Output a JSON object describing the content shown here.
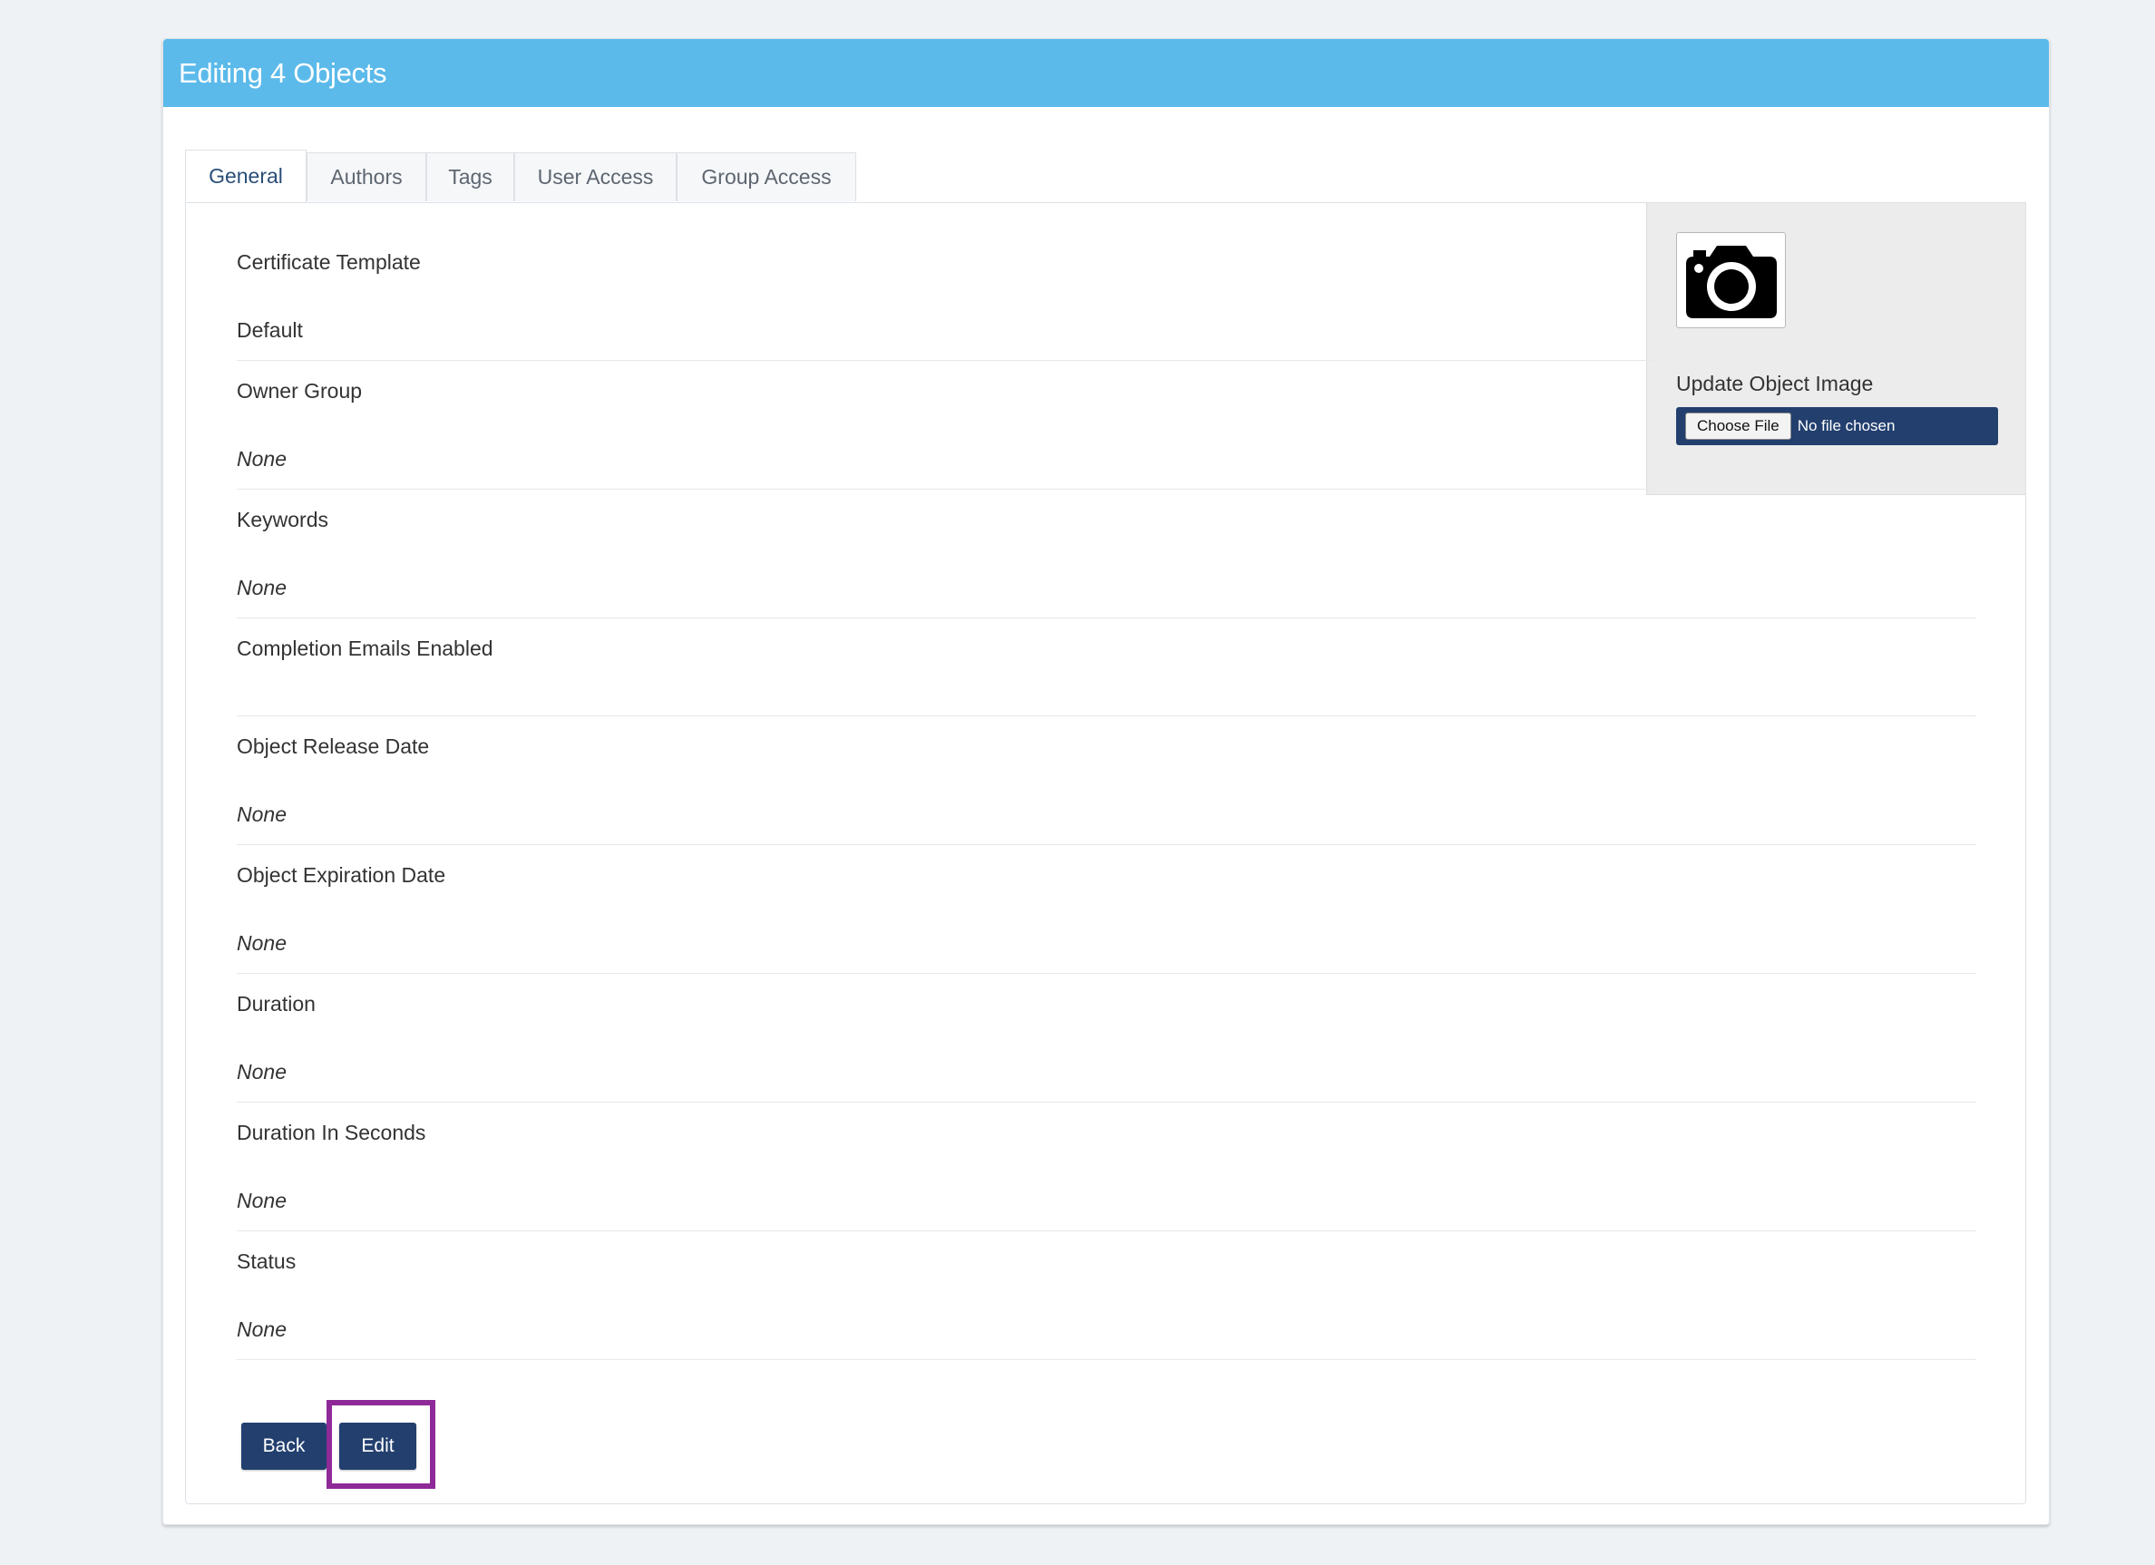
{
  "window": {
    "title": "Editing 4 Objects"
  },
  "tabs": [
    {
      "label": "General",
      "active": true
    },
    {
      "label": "Authors",
      "active": false
    },
    {
      "label": "Tags",
      "active": false
    },
    {
      "label": "User Access",
      "active": false
    },
    {
      "label": "Group Access",
      "active": false
    }
  ],
  "image_panel": {
    "icon": "camera-icon",
    "label": "Update Object Image",
    "choose_file_label": "Choose File",
    "file_status": "No file chosen"
  },
  "fields": [
    {
      "label": "Certificate Template",
      "value": "Default"
    },
    {
      "label": "Owner Group",
      "value": "None"
    },
    {
      "label": "Keywords",
      "value": "None"
    },
    {
      "label": "Completion Emails Enabled",
      "value": ""
    },
    {
      "label": "Object Release Date",
      "value": "None"
    },
    {
      "label": "Object Expiration Date",
      "value": "None"
    },
    {
      "label": "Duration",
      "value": "None"
    },
    {
      "label": "Duration In Seconds",
      "value": "None"
    },
    {
      "label": "Status",
      "value": "None"
    }
  ],
  "actions": {
    "back_label": "Back",
    "edit_label": "Edit"
  },
  "colors": {
    "header_bg": "#5bbaea",
    "button_bg": "#223f6e",
    "highlight": "#8e2a97",
    "active_tab_text": "#2b4e78"
  }
}
